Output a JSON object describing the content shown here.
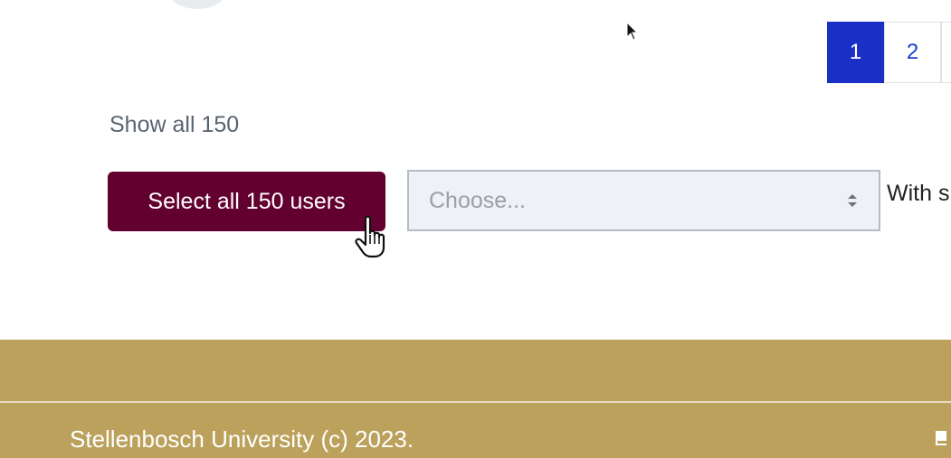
{
  "pagination": {
    "pages": [
      "1",
      "2"
    ],
    "active": "1"
  },
  "show_all": {
    "label": "Show all 150"
  },
  "actions": {
    "select_all_label": "Select all 150 users",
    "with_selected_label": "With s",
    "choose_select": {
      "placeholder": "Choose..."
    }
  },
  "footer": {
    "copyright": "Stellenbosch University (c) 2023."
  },
  "colors": {
    "brand_maroon": "#62002f",
    "footer_gold": "#bba15b",
    "pagination_active": "#1a2fc4"
  },
  "icons": {
    "select_arrows": "sort-arrows-icon",
    "footer_icon": "document-icon",
    "mouse_pointer": "cursor-arrow-icon",
    "hand_cursor": "cursor-hand-icon"
  }
}
